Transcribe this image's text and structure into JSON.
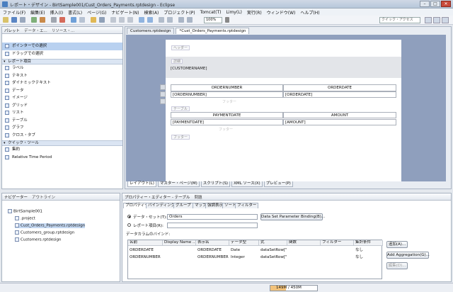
{
  "window": {
    "title": "レポート・デザイン - BirtSample001/Cust_Orders_Payments.rptdesign - Eclipse",
    "minimize": "–",
    "maximize": "□",
    "close": "✕"
  },
  "menu": [
    "ファイル(F)",
    "編集(E)",
    "挿入(I)",
    "書式(L)",
    "ページ(G)",
    "ナビゲート(N)",
    "検索(A)",
    "プロジェクト(P)",
    "Tomcat(T)",
    "Limy(L)",
    "実行(R)",
    "ウィンドウ(W)",
    "ヘルプ(H)"
  ],
  "toolbar": {
    "zoom": "100%",
    "quick_access": "クイック・アクセス"
  },
  "palette": {
    "tabs": [
      "パレット",
      "データ・エ...",
      "リソース・..."
    ],
    "pointer": "ポインターでの選択",
    "drag": "ドラッグでの選択",
    "section_items": "レポート項目",
    "items": [
      "ラベル",
      "テキスト",
      "ダイナミックテキスト",
      "データ",
      "イメージ",
      "グリッド",
      "リスト",
      "テーブル",
      "グラフ",
      "クロス・タブ"
    ],
    "section_quick": "クイック・ツール",
    "quick_items": [
      "集約",
      "Relative Time Period"
    ]
  },
  "editor": {
    "tabs": [
      "Customers.rptdesign",
      "*Cust_Orders_Payments.rptdesign"
    ],
    "header_band": "ヘッダー",
    "detail_band": "詳細",
    "customername": "[CUSTOMERNAME]",
    "orders_table": {
      "headers": [
        "ORDERNUMBER",
        "ORDERDATE"
      ],
      "row": [
        "[ORDERNUMBER]",
        "[ORDERDATE]"
      ],
      "footer": "フッター"
    },
    "table_label": "テーブル",
    "payments_table": {
      "headers": [
        "PAYMENTDATE",
        "AMOUNT"
      ],
      "row": [
        "[PAYMENTDATE]",
        "[AMOUNT]"
      ],
      "footer": "フッター"
    },
    "footer_band": "フッター",
    "bottom_tabs": [
      "レイアウト(L)",
      "マスター・ページ(M)",
      "スクリプト(S)",
      "XML ソース(X)",
      "プレビュー(P)"
    ]
  },
  "navigator": {
    "tabs": [
      "ナビゲーター",
      "アウトライン"
    ],
    "project": "BirtSample001",
    "files": [
      ".project",
      "Cust_Orders_Payments.rptdesign",
      "Customers_group.rptdesign",
      "Customers.rptdesign"
    ]
  },
  "properties": {
    "title_tabs": [
      "プロパティー・エディター - テーブル",
      "問題"
    ],
    "subtabs": [
      "プロパティー",
      "バインディング",
      "グループ",
      "マップ",
      "強調表示",
      "ソート",
      "フィルター"
    ],
    "dataset_label": "データ・セット(T):",
    "dataset_value": "Orders",
    "param_button": "Data Set Parameter Binding(B)...",
    "report_item_label": "レポート項目(R):",
    "binding_label": "データカラムのバインド:",
    "columns": [
      "名前",
      "Display Name ...",
      "表示名",
      "データ型",
      "式",
      "関数",
      "フィルター",
      "集計条件"
    ],
    "rows": [
      [
        "ORDERDATE",
        "",
        "ORDERDATE",
        "Date",
        "dataSetRow[\"...",
        "",
        "",
        "なし"
      ],
      [
        "ORDERNUMBER",
        "",
        "ORDERNUMBER",
        "Integer",
        "dataSetRow[\"...",
        "",
        "",
        "なし"
      ]
    ],
    "add_button": "追加(A)...",
    "add_aggregation": "Add Aggregation(G)...",
    "edit_button": "編集(D)..."
  },
  "status": {
    "heap": "149M / 450M",
    "heap_fraction": 0.33
  }
}
